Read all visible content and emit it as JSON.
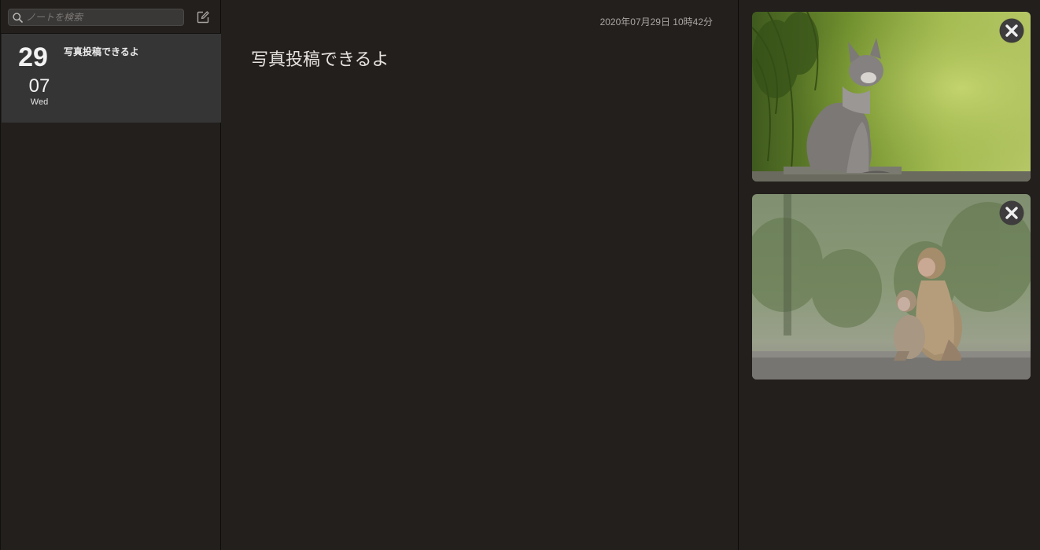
{
  "search": {
    "placeholder": "ノートを検索",
    "value": ""
  },
  "toolbar": {
    "compose_icon": "compose-icon"
  },
  "notes": [
    {
      "day": "29",
      "month": "07",
      "weekday": "Wed",
      "title": "写真投稿できるよ"
    }
  ],
  "editor": {
    "timestamp": "2020年07月29日 10時42分",
    "body": "写真投稿できるよ"
  },
  "images": [
    {
      "subject": "kitten",
      "close_icon": "close-icon"
    },
    {
      "subject": "monkeys",
      "close_icon": "close-icon"
    }
  ],
  "colors": {
    "background": "#221f1d",
    "selected_note": "#363536",
    "close_button": "#4a4848"
  }
}
